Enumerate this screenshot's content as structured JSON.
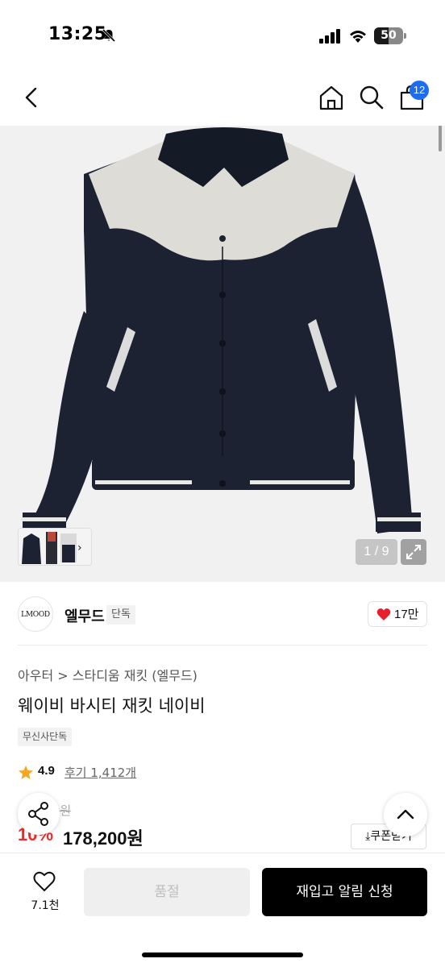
{
  "status_bar": {
    "time": "13:25",
    "battery": "50",
    "battery_level": 0.5
  },
  "nav": {
    "cart_count": "12"
  },
  "gallery": {
    "counter": "1 / 9",
    "current": 1,
    "total": 9
  },
  "brand": {
    "logo_text": "LMOOD",
    "name": "엘무드",
    "tag": "단독",
    "like_count": "17만"
  },
  "product": {
    "breadcrumb": [
      "아우터",
      "스타디움 재킷 (엘무드)"
    ],
    "breadcrumb_sep": ">",
    "title": "웨이비 바시티 재킷 네이비",
    "exclusive_badge": "무신사단독",
    "rating": "4.9",
    "reviews": "후기 1,412개",
    "original_price": "0원",
    "discount": "10%",
    "price": "178,200원",
    "coupon_label": "쿠폰받기"
  },
  "bottom_bar": {
    "wish_count": "7.1천",
    "soldout_label": "품절",
    "restock_label": "재입고 알림 신청"
  },
  "colors": {
    "accent_blue": "#1e6cf0",
    "discount_red": "#ee2c2c",
    "heart_red": "#e8202e",
    "star_orange": "#f5a623",
    "jacket_navy": "#1c2231",
    "jacket_cream": "#dedcd6"
  },
  "icons": [
    "back-icon",
    "home-icon",
    "search-icon",
    "cart-icon",
    "share-icon",
    "chevron-up-icon",
    "heart-icon",
    "star-icon",
    "expand-icon",
    "download-icon"
  ]
}
